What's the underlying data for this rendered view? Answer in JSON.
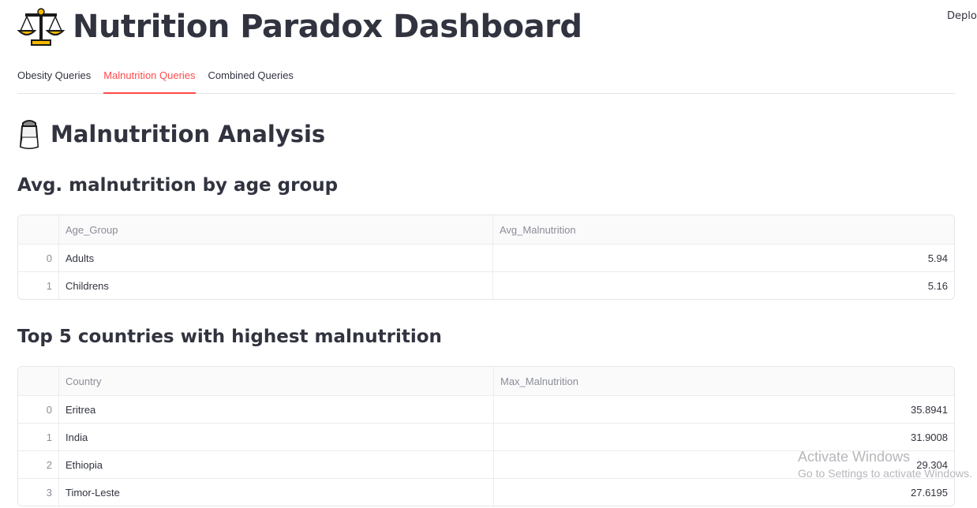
{
  "header": {
    "deploy_label": "Deploy",
    "title": "Nutrition Paradox Dashboard",
    "title_icon": "balance-scale-icon"
  },
  "tabs": [
    {
      "label": "Obesity Queries",
      "active": false
    },
    {
      "label": "Malnutrition Queries",
      "active": true
    },
    {
      "label": "Combined Queries",
      "active": false
    }
  ],
  "main": {
    "section_title": "Malnutrition Analysis",
    "section_icon": "salt-shaker-icon",
    "table1": {
      "title": "Avg. malnutrition by age group",
      "columns": [
        "",
        "Age_Group",
        "Avg_Malnutrition"
      ],
      "rows": [
        {
          "index": "0",
          "col1": "Adults",
          "col2": "5.94"
        },
        {
          "index": "1",
          "col1": "Childrens",
          "col2": "5.16"
        }
      ]
    },
    "table2": {
      "title": "Top 5 countries with highest malnutrition",
      "columns": [
        "",
        "Country",
        "Max_Malnutrition"
      ],
      "rows": [
        {
          "index": "0",
          "col1": "Eritrea",
          "col2": "35.8941"
        },
        {
          "index": "1",
          "col1": "India",
          "col2": "31.9008"
        },
        {
          "index": "2",
          "col1": "Ethiopia",
          "col2": "29.304"
        },
        {
          "index": "3",
          "col1": "Timor-Leste",
          "col2": "27.6195"
        }
      ]
    }
  },
  "watermark": {
    "line1": "Activate Windows",
    "line2": "Go to Settings to activate Windows."
  },
  "colors": {
    "accent": "#ff4b4b",
    "text": "#31333f",
    "muted": "#8b8d98",
    "border": "#e6e6ea"
  }
}
